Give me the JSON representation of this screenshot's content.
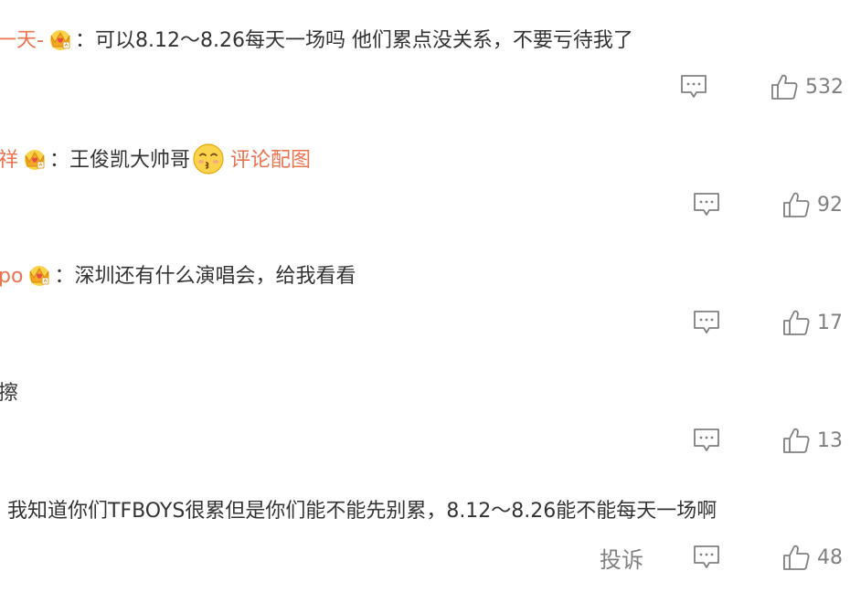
{
  "icons": {
    "badge": "crown-badge-icon",
    "emoji": "kiss-emoji-icon",
    "reply": "comment-bubble-icon",
    "like": "thumbs-up-icon"
  },
  "colors": {
    "username": "#eb7350",
    "text": "#333333",
    "muted": "#808080",
    "crown": "#f5a623",
    "heart": "#e84a4a"
  },
  "comments": [
    {
      "username": "一天-",
      "colon": "：",
      "text": "可以8.12～8.26每天一场吗 他们累点没关系，不要亏待我了",
      "likes": "532"
    },
    {
      "username": "祥",
      "colon": "：",
      "text": "王俊凯大帅哥",
      "link": "评论配图",
      "likes": "92"
    },
    {
      "username": "po",
      "colon": "：",
      "text": "深圳还有什么演唱会，给我看看",
      "likes": "17"
    },
    {
      "text": "擦",
      "likes": "13"
    },
    {
      "text": "我知道你们TFBOYS很累但是你们能不能先别累，8.12～8.26能不能每天一场啊",
      "report": "投诉",
      "likes": "48"
    }
  ]
}
